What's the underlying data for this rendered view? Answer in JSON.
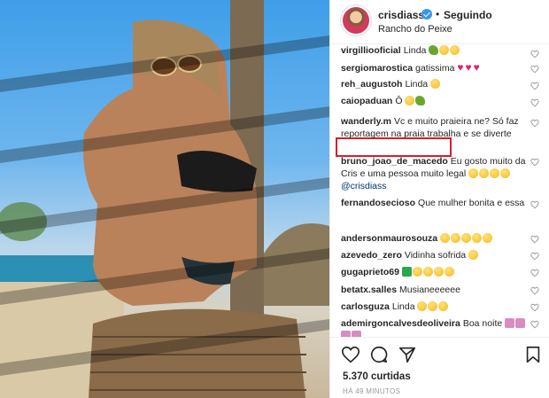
{
  "post": {
    "username": "crisdiass",
    "separator": "•",
    "follow_label": "Seguindo",
    "location": "Rancho do Peixe",
    "likes_text": "5.370 curtidas",
    "time_text": "HÁ 49 MINUTOS"
  },
  "comments": [
    {
      "user": "virgilliooficial",
      "text": "Linda",
      "emoji": [
        "t",
        "y",
        "y"
      ]
    },
    {
      "user": "sergiomarostica",
      "text": "gatissima",
      "emoji": [
        "heart",
        "heart",
        "heart"
      ]
    },
    {
      "user": "reh_augustoh",
      "text": "Linda",
      "emoji": [
        "y"
      ]
    },
    {
      "user": "caiopaduan",
      "text": "Ô",
      "emoji": [
        "y",
        "t"
      ]
    },
    {
      "user": "wanderly.m",
      "text": "Vc e muito praieira ne? Só faz reportagem na praia trabalha e se diverte",
      "emoji": []
    },
    {
      "user": "bruno_joao_de_macedo",
      "text": "Eu gosto muito da Cris e uma pessoa muito legal",
      "emoji": [
        "y",
        "y",
        "y",
        "y"
      ],
      "mention": "@crisdiass"
    },
    {
      "user": "fernandosecioso",
      "text": "Que mulher bonita e essa",
      "emoji": []
    },
    {
      "user": "andersonmaurosouza",
      "text": "",
      "emoji": [
        "y",
        "y",
        "y",
        "y",
        "y"
      ]
    },
    {
      "user": "azevedo_zero",
      "text": "Vidinha sofrida",
      "emoji": [
        "y"
      ]
    },
    {
      "user": "gugaprieto69",
      "text": "",
      "emoji": [
        "g",
        "y",
        "y",
        "y",
        "y"
      ]
    },
    {
      "user": "betatx.salles",
      "text": "Musianeeeeee",
      "emoji": []
    },
    {
      "user": "carlosguza",
      "text": "Linda",
      "emoji": [
        "y",
        "y",
        "y"
      ]
    },
    {
      "user": "ademirgoncalvesdeoliveira",
      "text": "Boa noite",
      "emoji": [
        "c",
        "c",
        "c",
        "c"
      ]
    }
  ],
  "icons": {
    "verified": "verified-badge-icon",
    "like": "heart-outline-icon",
    "comment": "speech-bubble-icon",
    "share": "paper-plane-icon",
    "save": "bookmark-icon"
  },
  "colors": {
    "highlight_box": "#d1212b",
    "verified": "#3897f0",
    "text": "#262626",
    "muted": "#999999"
  }
}
